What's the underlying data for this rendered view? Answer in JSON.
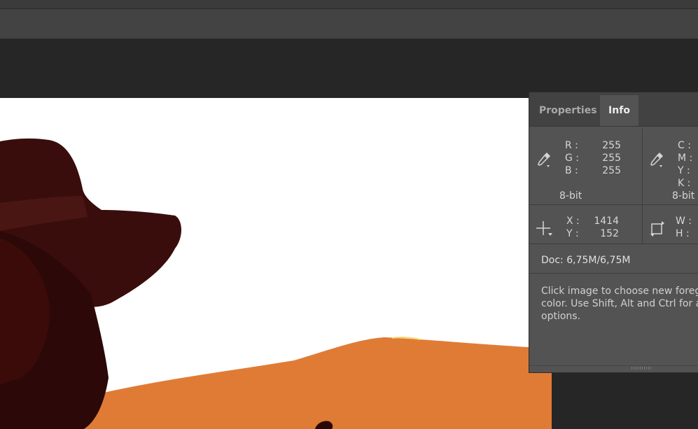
{
  "colors": {
    "canvas": "#ffffff",
    "dune": "#e07b36",
    "silhouette": "#3a0d0d",
    "panel": "#535353",
    "workspace": "#262626"
  },
  "panel": {
    "tabs": [
      {
        "label": "Properties",
        "active": false
      },
      {
        "label": "Info",
        "active": true
      }
    ],
    "rgb": {
      "labels": [
        "R :",
        "G :",
        "B :"
      ],
      "values": [
        "255",
        "255",
        "255"
      ],
      "bit_depth": "8-bit",
      "icon": "eyedropper-icon"
    },
    "cmyk": {
      "labels": [
        "C :",
        "M :",
        "Y :",
        "K :"
      ],
      "bit_depth": "8-bit",
      "icon": "eyedropper-icon"
    },
    "position": {
      "labels": [
        "X :",
        "Y :"
      ],
      "values": [
        "1414",
        "152"
      ],
      "icon": "crosshair-icon"
    },
    "size": {
      "labels": [
        "W :",
        "H :"
      ],
      "icon": "selection-size-icon"
    },
    "doc": "Doc: 6,75M/6,75M",
    "hint": [
      "Click image to choose new foreground",
      "color.  Use Shift, Alt and Ctrl for additional",
      "options."
    ]
  }
}
